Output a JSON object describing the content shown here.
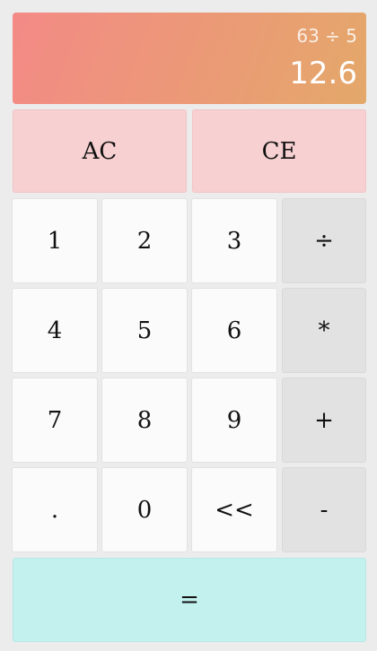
{
  "display": {
    "expression": "63 ÷ 5",
    "result": "12.6"
  },
  "keys": {
    "ac": "AC",
    "ce": "CE",
    "one": "1",
    "two": "2",
    "three": "3",
    "divide": "÷",
    "four": "4",
    "five": "5",
    "six": "6",
    "multiply": "*",
    "seven": "7",
    "eight": "8",
    "nine": "9",
    "plus": "+",
    "decimal": ".",
    "zero": "0",
    "backspace": "<<",
    "minus": "-",
    "equals": "="
  },
  "colors": {
    "display_gradient_start": "#f38a86",
    "display_gradient_end": "#e4a86a",
    "clear_key": "#f7d0d1",
    "operator_key": "#e2e2e2",
    "digit_key": "#fbfbfb",
    "equals_key": "#c2f1ee"
  }
}
